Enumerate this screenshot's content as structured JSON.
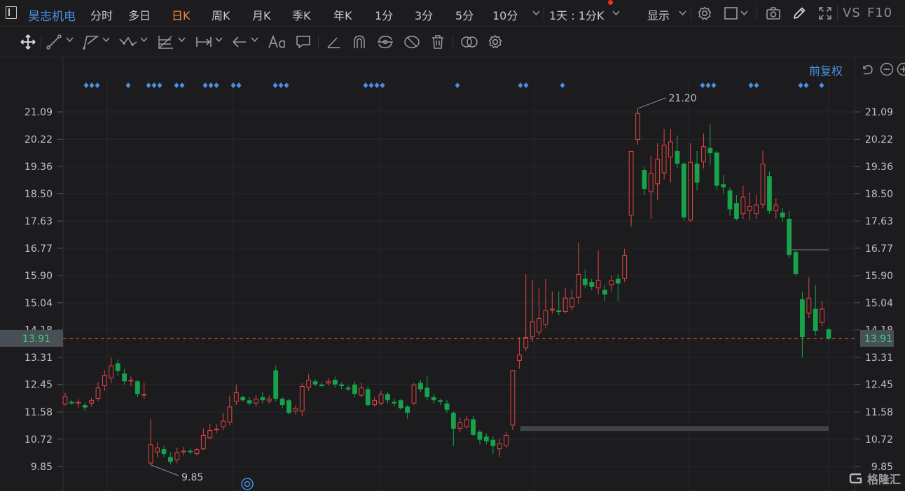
{
  "stock": {
    "name": "昊志机电"
  },
  "tabs": [
    {
      "label": "分时",
      "active": false
    },
    {
      "label": "多日",
      "active": false
    },
    {
      "label": "日K",
      "active": true
    },
    {
      "label": "周K",
      "active": false
    },
    {
      "label": "月K",
      "active": false
    },
    {
      "label": "季K",
      "active": false
    },
    {
      "label": "年K",
      "active": false
    },
    {
      "label": "1分",
      "active": false
    },
    {
      "label": "3分",
      "active": false
    },
    {
      "label": "5分",
      "active": false
    },
    {
      "label": "10分",
      "active": false
    }
  ],
  "period_selector": "1天 : 1分K",
  "display_menu": "显示",
  "toolbar_right": {
    "vs": "VS",
    "f10": "F10"
  },
  "adjust_label": "前复权",
  "icons": {
    "top": [
      "settings-icon",
      "square-icon",
      "camera-icon",
      "pencil-icon",
      "fullscreen-icon"
    ],
    "drawing": [
      "move-icon",
      "line-tool-icon",
      "polyline-tool-icon",
      "wave-tool-icon",
      "fib-tool-icon",
      "measure-tool-icon",
      "arrow-tool-icon",
      "text-tool-icon",
      "comment-tool-icon",
      "angle-tool-icon",
      "magnet-icon",
      "cycle-icon",
      "hide-icon",
      "trash-icon",
      "compare-icon",
      "settings-icon"
    ],
    "chart_controls": [
      "undo-icon",
      "zoom-out-icon",
      "zoom-in-icon"
    ]
  },
  "colors": {
    "up": "#e5463f",
    "down": "#16a34a",
    "accent": "#4a90e2",
    "current_price": "#e0682a",
    "marker": "#4a90e2"
  },
  "watermark": "格隆汇",
  "chart_data": {
    "type": "candlestick",
    "ylim": [
      9.55,
      22.2
    ],
    "y_ticks": [
      "21.09",
      "20.22",
      "19.36",
      "18.50",
      "17.63",
      "16.77",
      "15.90",
      "15.04",
      "14.18",
      "13.31",
      "12.45",
      "11.58",
      "10.72",
      "9.85"
    ],
    "current_price": "13.91",
    "max_label": "21.20",
    "min_label": "9.85",
    "ohlc": [
      [
        11.82,
        12.08,
        11.78,
        12.18
      ],
      [
        11.9,
        11.85,
        11.8,
        11.96
      ],
      [
        11.85,
        11.9,
        11.72,
        11.98
      ],
      [
        11.8,
        11.72,
        11.62,
        11.88
      ],
      [
        11.85,
        11.95,
        11.75,
        12.02
      ],
      [
        12.0,
        12.35,
        11.92,
        12.52
      ],
      [
        12.4,
        12.75,
        12.25,
        12.9
      ],
      [
        12.65,
        13.05,
        12.5,
        13.3
      ],
      [
        13.12,
        12.88,
        12.72,
        13.25
      ],
      [
        12.8,
        12.55,
        12.45,
        12.95
      ],
      [
        12.55,
        12.6,
        12.4,
        12.7
      ],
      [
        12.55,
        12.15,
        12.05,
        12.6
      ],
      [
        12.1,
        12.15,
        12.0,
        12.5
      ],
      [
        9.95,
        10.55,
        9.9,
        11.35
      ],
      [
        10.3,
        10.45,
        10.15,
        10.62
      ],
      [
        10.4,
        10.25,
        10.15,
        10.5
      ],
      [
        10.15,
        10.0,
        9.92,
        10.3
      ],
      [
        10.05,
        10.3,
        9.95,
        10.45
      ],
      [
        10.3,
        10.35,
        10.2,
        10.48
      ],
      [
        10.35,
        10.3,
        10.25,
        10.42
      ],
      [
        10.25,
        10.4,
        10.2,
        10.45
      ],
      [
        10.4,
        10.85,
        10.38,
        11.05
      ],
      [
        10.75,
        11.0,
        10.72,
        11.2
      ],
      [
        11.0,
        11.05,
        10.9,
        11.2
      ],
      [
        11.1,
        11.3,
        11.0,
        11.55
      ],
      [
        11.25,
        11.75,
        11.15,
        12.1
      ],
      [
        11.9,
        12.2,
        11.8,
        12.45
      ],
      [
        12.05,
        11.95,
        11.9,
        12.1
      ],
      [
        11.95,
        11.85,
        11.8,
        12.05
      ],
      [
        11.85,
        12.0,
        11.75,
        12.1
      ],
      [
        12.05,
        11.95,
        11.85,
        12.2
      ],
      [
        11.92,
        12.0,
        11.85,
        12.1
      ],
      [
        12.9,
        12.0,
        11.9,
        13.05
      ],
      [
        12.0,
        11.8,
        11.7,
        12.05
      ],
      [
        11.95,
        11.55,
        11.5,
        12.0
      ],
      [
        11.6,
        11.7,
        11.5,
        11.78
      ],
      [
        11.6,
        12.4,
        11.45,
        12.5
      ],
      [
        12.35,
        12.6,
        12.25,
        12.78
      ],
      [
        12.55,
        12.45,
        12.4,
        12.62
      ],
      [
        12.45,
        12.4,
        12.35,
        12.52
      ],
      [
        12.48,
        12.55,
        12.4,
        12.65
      ],
      [
        12.6,
        12.45,
        12.35,
        12.7
      ],
      [
        12.45,
        12.4,
        12.3,
        12.52
      ],
      [
        12.35,
        12.3,
        12.25,
        12.42
      ],
      [
        12.45,
        12.15,
        12.05,
        12.55
      ],
      [
        12.1,
        12.35,
        12.05,
        12.5
      ],
      [
        12.3,
        11.8,
        11.75,
        12.4
      ],
      [
        11.8,
        11.95,
        11.75,
        12.05
      ],
      [
        11.85,
        12.15,
        11.8,
        12.25
      ],
      [
        12.15,
        11.95,
        11.85,
        12.22
      ],
      [
        11.9,
        11.85,
        11.75,
        12.0
      ],
      [
        11.95,
        11.7,
        11.65,
        12.0
      ],
      [
        11.75,
        11.55,
        11.35,
        11.8
      ],
      [
        11.85,
        12.45,
        11.8,
        12.5
      ],
      [
        12.5,
        12.3,
        12.2,
        12.6
      ],
      [
        12.35,
        12.05,
        11.95,
        12.7
      ],
      [
        12.05,
        11.95,
        11.85,
        12.15
      ],
      [
        11.95,
        11.9,
        11.8,
        12.0
      ],
      [
        11.85,
        11.65,
        11.55,
        11.95
      ],
      [
        11.55,
        11.05,
        10.5,
        11.6
      ],
      [
        11.05,
        11.25,
        10.95,
        11.4
      ],
      [
        11.1,
        11.35,
        11.05,
        11.45
      ],
      [
        11.35,
        10.85,
        10.8,
        11.45
      ],
      [
        10.95,
        10.7,
        10.55,
        11.0
      ],
      [
        10.8,
        10.65,
        10.55,
        10.9
      ],
      [
        10.7,
        10.5,
        10.25,
        10.8
      ],
      [
        10.4,
        10.58,
        10.15,
        10.72
      ],
      [
        10.5,
        10.85,
        10.45,
        10.95
      ],
      [
        11.15,
        12.9,
        11.0,
        12.9
      ],
      [
        13.2,
        13.4,
        12.95,
        13.95
      ],
      [
        13.6,
        13.95,
        13.5,
        15.95
      ],
      [
        13.95,
        14.45,
        13.8,
        15.75
      ],
      [
        14.1,
        14.55,
        14.0,
        15.5
      ],
      [
        14.35,
        14.8,
        14.25,
        15.8
      ],
      [
        14.8,
        14.85,
        14.7,
        15.4
      ],
      [
        14.8,
        14.75,
        14.65,
        15.4
      ],
      [
        14.75,
        15.2,
        14.7,
        15.5
      ],
      [
        14.9,
        15.2,
        14.8,
        15.45
      ],
      [
        15.2,
        15.95,
        15.0,
        16.95
      ],
      [
        15.8,
        15.6,
        15.5,
        16.1
      ],
      [
        15.7,
        15.55,
        15.45,
        15.8
      ],
      [
        15.5,
        15.75,
        15.3,
        16.7
      ],
      [
        15.45,
        15.3,
        15.1,
        15.6
      ],
      [
        15.6,
        15.75,
        15.4,
        15.9
      ],
      [
        15.8,
        15.65,
        15.1,
        15.95
      ],
      [
        15.8,
        16.55,
        15.7,
        16.75
      ],
      [
        17.8,
        19.85,
        17.45,
        19.85
      ],
      [
        20.2,
        21.05,
        20.05,
        21.2
      ],
      [
        19.25,
        18.65,
        18.45,
        19.35
      ],
      [
        18.55,
        19.15,
        17.7,
        19.7
      ],
      [
        18.8,
        19.6,
        18.3,
        20.1
      ],
      [
        19.15,
        20.05,
        18.95,
        20.55
      ],
      [
        19.65,
        20.15,
        18.85,
        20.55
      ],
      [
        19.85,
        19.45,
        19.3,
        20.35
      ],
      [
        19.45,
        17.75,
        17.65,
        19.5
      ],
      [
        17.65,
        19.5,
        17.6,
        20.1
      ],
      [
        19.45,
        18.85,
        18.6,
        19.85
      ],
      [
        19.5,
        20.0,
        19.3,
        20.4
      ],
      [
        19.95,
        19.78,
        19.4,
        20.7
      ],
      [
        19.8,
        18.75,
        18.6,
        19.85
      ],
      [
        18.8,
        18.7,
        18.5,
        19.1
      ],
      [
        18.6,
        18.0,
        17.8,
        18.7
      ],
      [
        18.2,
        17.7,
        17.65,
        18.45
      ],
      [
        17.85,
        18.4,
        17.7,
        18.75
      ],
      [
        17.95,
        18.1,
        17.65,
        18.55
      ],
      [
        17.85,
        18.15,
        17.7,
        18.45
      ],
      [
        18.15,
        19.45,
        18.05,
        19.85
      ],
      [
        19.05,
        17.95,
        17.85,
        19.2
      ],
      [
        17.95,
        18.15,
        17.7,
        18.35
      ],
      [
        17.9,
        17.75,
        17.6,
        18.05
      ],
      [
        17.7,
        16.55,
        16.45,
        17.95
      ],
      [
        16.65,
        15.95,
        15.9,
        16.7
      ],
      [
        15.15,
        13.95,
        13.31,
        15.4
      ],
      [
        14.7,
        15.2,
        14.55,
        15.85
      ],
      [
        14.85,
        14.15,
        14.0,
        15.6
      ],
      [
        14.4,
        14.85,
        14.3,
        15.1
      ],
      [
        14.2,
        13.91,
        13.85,
        14.25
      ]
    ],
    "event_marker_rows": [
      "◆◆◆",
      "◆",
      "◆◆◆",
      "◆◆",
      "◆◆◆",
      "◆◆",
      "◆◆◆",
      "◆◆◆◆",
      "◆",
      "◆◆",
      "◆",
      "◆◆◆",
      "◆◆",
      "◆◆",
      "◆"
    ]
  }
}
